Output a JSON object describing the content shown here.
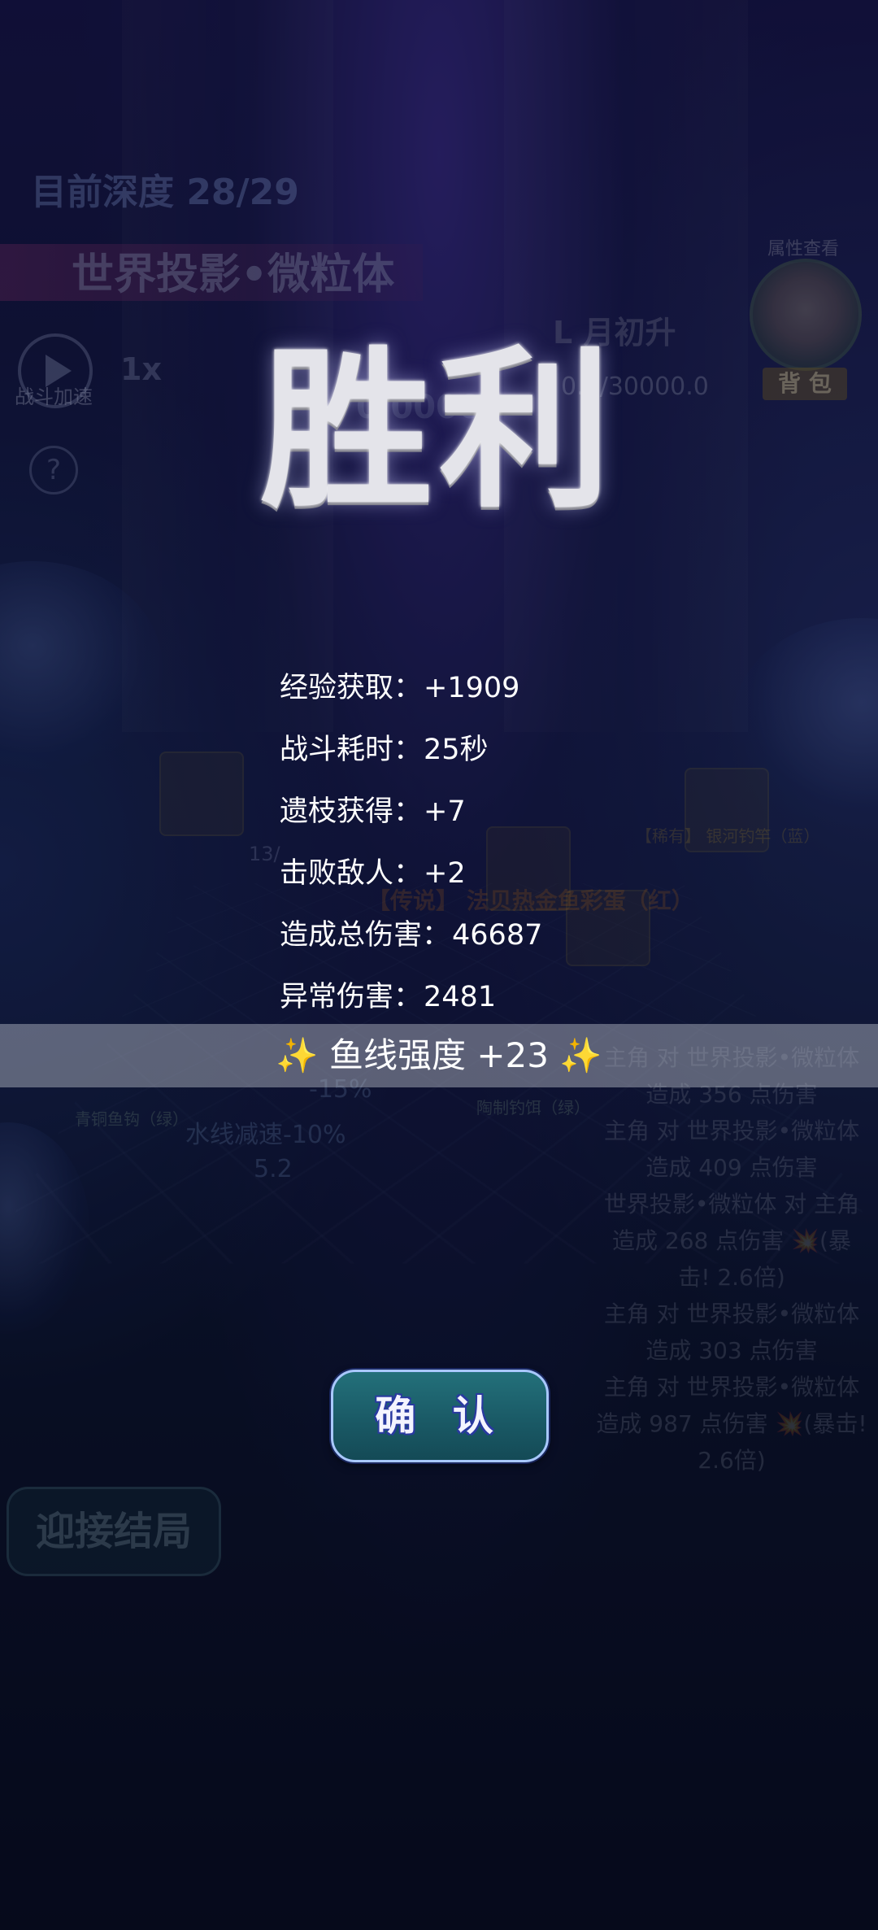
{
  "background": {
    "depth_label": "目前深度 28/29",
    "boss_name": "世界投影•微粒体",
    "speed_label": "战斗加速",
    "speed_value": "1x",
    "help_icon": "?",
    "level_text": "L 月初升",
    "hp_text": "0.0/30000.0",
    "hp_left": "0/0000",
    "attr_view_label": "属性查看",
    "bag_label": "背 包",
    "enemy_counter": "13/",
    "legend_item": "【传说】 法贝热金鱼彩蛋（红）",
    "rare_item": "【稀有】 银河钓竿（蓝）",
    "item_green_1": "青铜鱼钩（绿）",
    "item_green_2": "陶制钓饵（绿）",
    "status_1": "水线减速-10%",
    "status_2": "5.2",
    "status_3": "-15%",
    "combat_log": [
      "主角 对 世界投影•微粒体",
      "造成 356 点伤害",
      "主角 对 世界投影•微粒体",
      "造成 409 点伤害",
      "世界投影•微粒体 对 主角",
      "造成 268 点伤害 💥(暴",
      "击! 2.6倍)",
      "主角 对 世界投影•微粒体",
      "造成 303 点伤害",
      "主角 对 世界投影•微粒体",
      "造成 987 点伤害 💥(暴击!",
      "2.6倍)"
    ],
    "end_button_label": "迎接结局"
  },
  "victory": {
    "title": "胜利",
    "stats": [
      {
        "label": "经验获取：",
        "value": "+1909"
      },
      {
        "label": "战斗耗时：",
        "value": "25秒"
      },
      {
        "label": "遗枝获得：",
        "value": "+7"
      },
      {
        "label": "击败敌人：",
        "value": "+2"
      },
      {
        "label": "造成总伤害：",
        "value": "46687"
      },
      {
        "label": "异常伤害：",
        "value": "2481"
      }
    ],
    "banner": {
      "left_spark": "✨",
      "text": "鱼线强度 +23",
      "right_spark": "✨"
    },
    "confirm_label": "确 认"
  },
  "colors": {
    "banner_bg": "#c8cdd7",
    "confirm_bg": "#1a5a66",
    "confirm_border": "#a9c8ff",
    "spark": "#ffd84a"
  }
}
